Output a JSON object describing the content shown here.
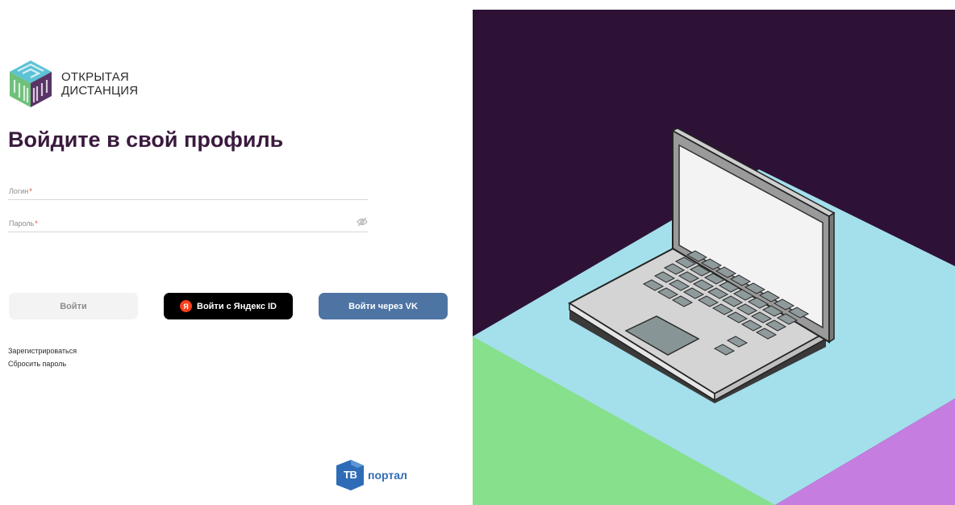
{
  "brand": {
    "line1": "ОТКРЫТАЯ",
    "line2": "ДИСТАНЦИЯ"
  },
  "form": {
    "title": "Войдите в свой профиль",
    "login_label": "Логин",
    "password_label": "Пароль",
    "required_mark": "*",
    "password_visibility_icon": "eye-off-icon"
  },
  "buttons": {
    "login": "Войти",
    "yandex": "Войти с Яндекс ID",
    "yandex_icon": "Я",
    "vk": "Войти через VK"
  },
  "links": {
    "register": "Зарегистрироваться",
    "reset": "Сбросить пароль"
  },
  "footer": {
    "partner_abbr": "ТВ",
    "partner_word": "портал"
  },
  "colors": {
    "title": "#3a1a3d",
    "vk_button": "#4e74a3",
    "yandex_button": "#000000",
    "illustration_bg": "#2d1235",
    "illustration_cyan": "#a4dfec",
    "illustration_green": "#86e08c",
    "illustration_purple": "#c67de0"
  }
}
